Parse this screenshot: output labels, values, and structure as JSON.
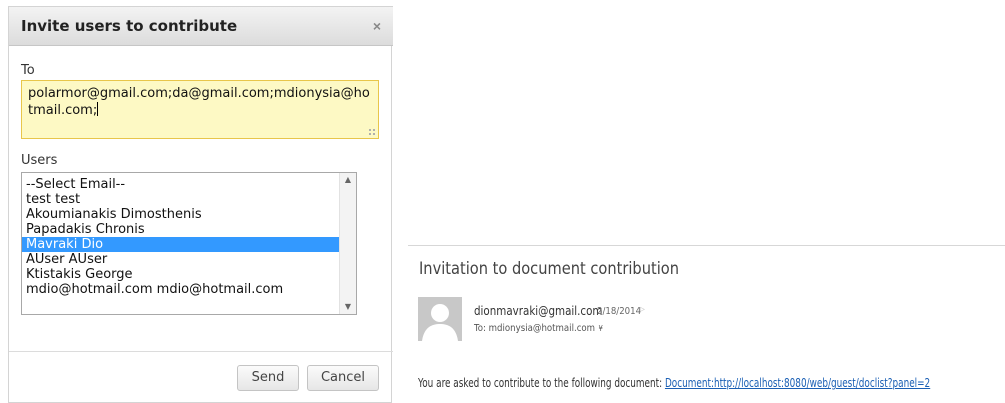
{
  "dialog": {
    "title": "Invite users to contribute",
    "close_glyph": "×",
    "to_label": "To",
    "to_value": "polarmor@gmail.com;da@gmail.com;mdionysia@hotmail.com;",
    "users_label": "Users",
    "users": [
      {
        "label": "--Select Email--",
        "selected": false
      },
      {
        "label": "test test",
        "selected": false
      },
      {
        "label": "Akoumianakis Dimosthenis",
        "selected": false
      },
      {
        "label": "Papadakis Chronis",
        "selected": false
      },
      {
        "label": "Mavraki Dio",
        "selected": true
      },
      {
        "label": "AUser AUser",
        "selected": false
      },
      {
        "label": "Ktistakis George",
        "selected": false
      },
      {
        "label": "mdio@hotmail.com mdio@hotmail.com",
        "selected": false
      }
    ],
    "send_label": "Send",
    "cancel_label": "Cancel"
  },
  "email": {
    "subject": "Invitation to document contribution",
    "sender": "dionmavraki@gmail.com",
    "date": "2/18/2014",
    "recipient_line": "To: mdionysia@hotmail.com",
    "body_text": "You are asked to contribute to the following document:",
    "link_text": "Document:http://localhost:8080/web/guest/doclist?panel=2"
  },
  "icons": {
    "close": "close-icon",
    "flag": "flag-icon",
    "expand": "expand-icon",
    "avatar": "person-avatar-icon",
    "scroll_up": "scroll-up-icon",
    "scroll_down": "scroll-down-icon",
    "resize": "resize-grip-icon"
  },
  "colors": {
    "selection": "#3399ff",
    "to_background": "#fdf9c4",
    "to_border": "#e8c64a",
    "link": "#1a5fb4"
  }
}
